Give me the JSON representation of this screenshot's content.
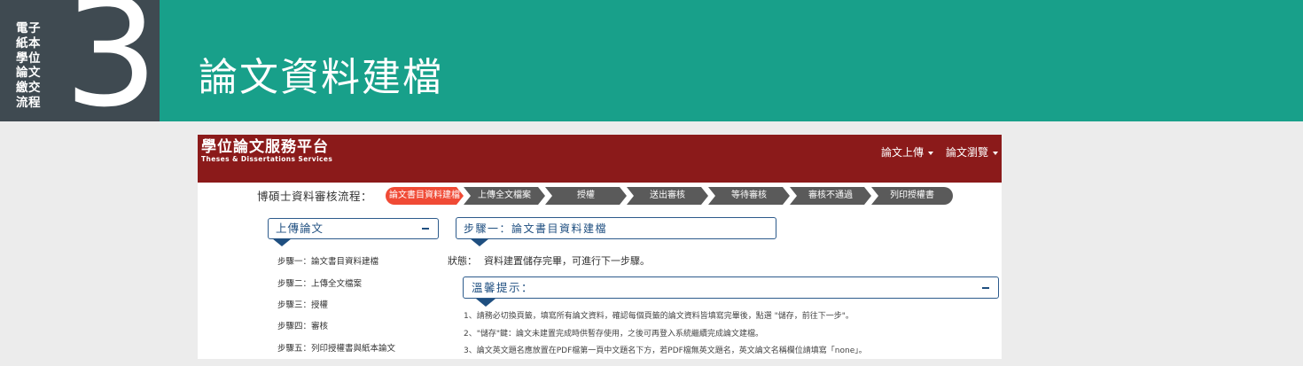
{
  "banner": {
    "flow_label": [
      "電子",
      "紙本",
      "學位",
      "論文",
      "繳交",
      "流程"
    ],
    "step_number": "3",
    "title": "論文資料建檔",
    "colors": {
      "left_bg": "#3f4a51",
      "right_bg": "#18a08a"
    }
  },
  "site": {
    "title": "學位論文服務平台",
    "subtitle": "Theses & Dissertations Services",
    "header_color": "#8b1a1a",
    "nav": [
      {
        "label": "論文上傳",
        "icon": "caret-down-icon"
      },
      {
        "label": "論文瀏覽",
        "icon": "caret-down-icon"
      }
    ]
  },
  "progress": {
    "label": "博碩士資料審核流程：",
    "steps": [
      {
        "label": "論文書目資料建檔",
        "active": true
      },
      {
        "label": "上傳全文檔案",
        "active": false
      },
      {
        "label": "授權",
        "active": false
      },
      {
        "label": "送出審核",
        "active": false
      },
      {
        "label": "等待審核",
        "active": false
      },
      {
        "label": "審核不通過",
        "active": false
      },
      {
        "label": "列印授權書",
        "active": false
      }
    ],
    "colors": {
      "active": "#f04a35",
      "inactive": "#5a5a5a"
    }
  },
  "sidebar": {
    "title": "上傳論文",
    "collapse_icon": "minus-icon",
    "items": [
      {
        "label": "步驟一：論文書目資料建檔"
      },
      {
        "label": "步驟二：上傳全文檔案"
      },
      {
        "label": "步驟三：授權"
      },
      {
        "label": "步驟四：審核"
      },
      {
        "label": "步驟五：列印授權書與紙本論文"
      }
    ]
  },
  "main": {
    "step_title": "步驟一：論文書目資料建檔",
    "status_label": "狀態：",
    "status_value": "資料建置儲存完畢，可進行下一步驟。",
    "tips": {
      "title": "溫馨提示：",
      "collapse_icon": "minus-icon",
      "items": [
        "1、請務必切換頁籤，填寫所有論文資料，確認每個頁籤的論文資料皆填寫完畢後，點選 \"儲存，前往下一步\"。",
        "2、\"儲存\"鍵：論文未建置完成時供暫存使用，之後可再登入系統繼續完成論文建檔。",
        "3、論文英文題名應放置在PDF檔第一頁中文題名下方，若PDF檔無英文題名，英文論文名稱欄位請填寫「none」。"
      ]
    }
  }
}
